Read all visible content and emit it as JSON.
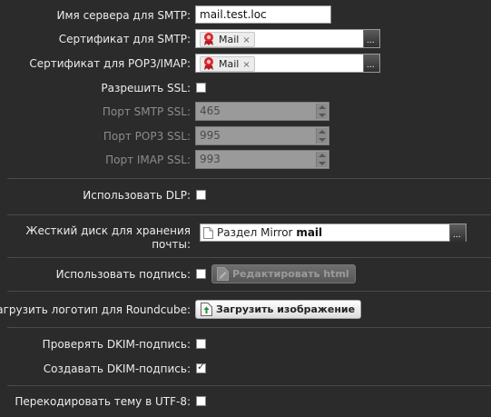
{
  "smtp_server": {
    "label": "Имя сервера для SMTP:",
    "value": "mail.test.loc"
  },
  "smtp_cert": {
    "label": "Сертификат для SMTP:",
    "tag": "Mail",
    "tag_remove": "×"
  },
  "pop_cert": {
    "label": "Сертификат для POP3/IMAP:",
    "tag": "Mail",
    "tag_remove": "×"
  },
  "ssl": {
    "label": "Разрешить SSL:",
    "checked": false
  },
  "smtp_ssl_port": {
    "label": "Порт SMTP SSL:",
    "value": "465"
  },
  "pop_ssl_port": {
    "label": "Порт POP3 SSL:",
    "value": "995"
  },
  "imap_ssl_port": {
    "label": "Порт IMAP SSL:",
    "value": "993"
  },
  "dlp": {
    "label": "Использовать DLP:",
    "checked": false
  },
  "storage": {
    "label": "Жесткий диск для хранения почты:",
    "value_prefix": "Раздел Mirror ",
    "value_name": "mail"
  },
  "signature": {
    "label": "Использовать подпись:",
    "checked": false,
    "button": "Редактировать html"
  },
  "logo": {
    "label": "Загрузить логотип для Roundcube:",
    "button": "Загрузить изображение"
  },
  "dkim_verify": {
    "label": "Проверять DKIM-подпись:",
    "checked": false
  },
  "dkim_create": {
    "label": "Создавать DKIM-подпись:",
    "checked": true
  },
  "utf8": {
    "label": "Перекодировать тему в UTF-8:",
    "checked": false
  },
  "icons": {
    "dots": "...",
    "check": "✓"
  }
}
